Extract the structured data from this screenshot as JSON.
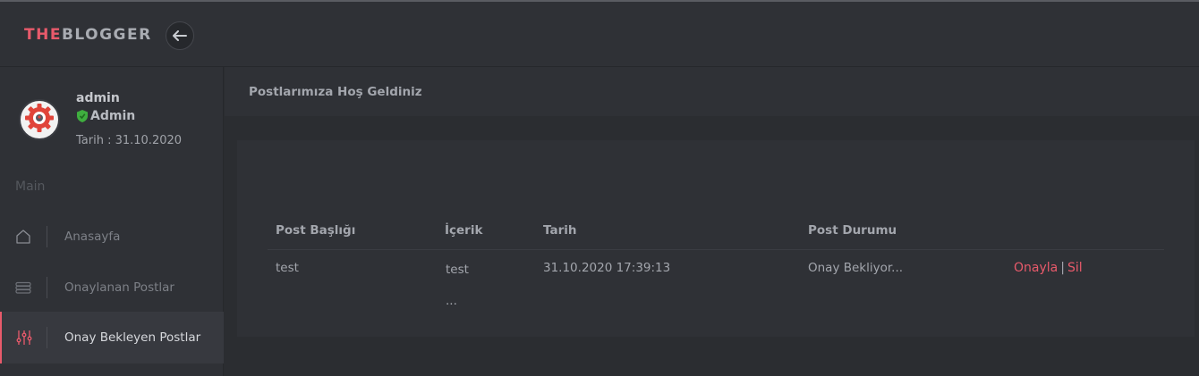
{
  "brand": {
    "part1": "THE",
    "part2": "BLOGGER",
    "accent_color": "#e85a6b"
  },
  "topbar": {
    "back_icon": "arrow-left-icon"
  },
  "user": {
    "name": "admin",
    "role": "Admin",
    "role_icon": "shield-icon",
    "date_label": "Tarih : 31.10.2020",
    "avatar_icon": "gear-logo-icon"
  },
  "sidebar": {
    "section": "Main",
    "items": [
      {
        "label": "Anasayfa",
        "icon": "home-icon",
        "active": false
      },
      {
        "label": "Onaylanan Postlar",
        "icon": "stack-icon",
        "active": false
      },
      {
        "label": "Onay Bekleyen Postlar",
        "icon": "sliders-icon",
        "active": true
      }
    ]
  },
  "header": {
    "title": "Postlarımıza Hoş Geldiniz"
  },
  "table": {
    "columns": [
      "Post Başlığı",
      "İçerik",
      "Tarih",
      "Post Durumu"
    ],
    "rows": [
      {
        "title": "test",
        "content": "test",
        "content_more": "...",
        "date": "31.10.2020 17:39:13",
        "status": "Onay Bekliyor...",
        "approve": "Onayla",
        "separator": "|",
        "delete": "Sil"
      }
    ]
  }
}
